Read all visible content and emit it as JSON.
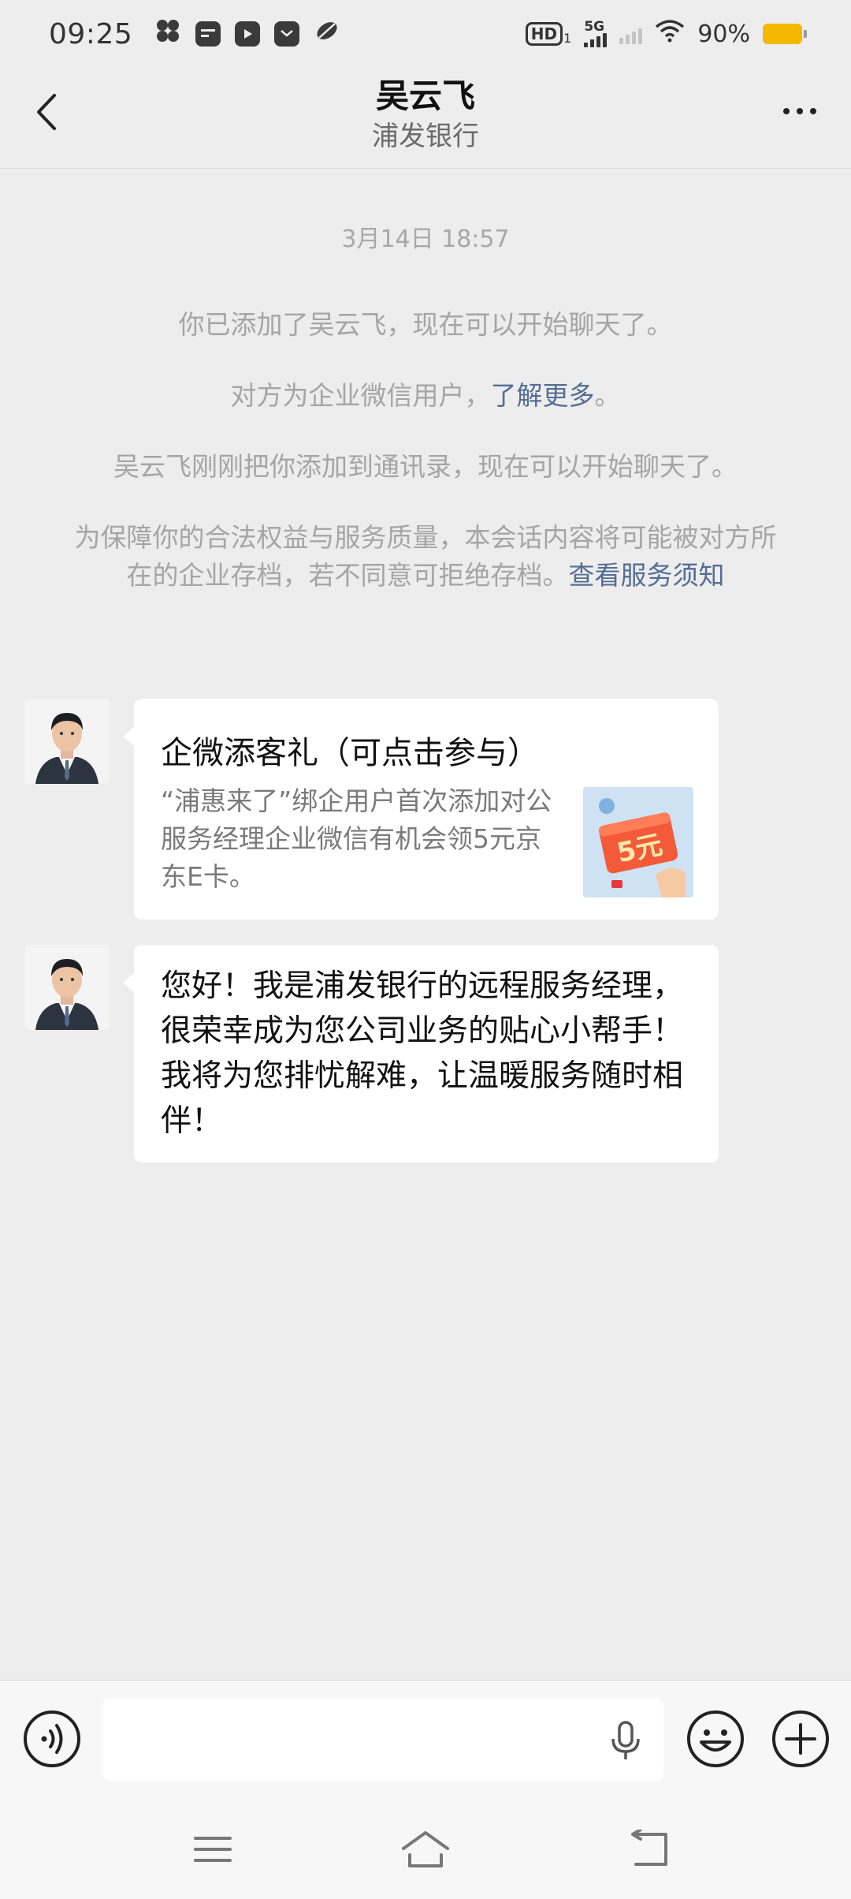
{
  "status_bar": {
    "time": "09:25",
    "network": "5G",
    "battery": "90%",
    "hd_label": "HD",
    "hd_sub": "1",
    "icons": [
      "fan-icon",
      "card-icon",
      "video-icon",
      "mail-icon",
      "leaf-icon",
      "wifi-icon"
    ]
  },
  "header": {
    "title": "吴云飞",
    "subtitle": "浦发银行"
  },
  "messages": {
    "timestamp": "3月14日 18:57",
    "system": [
      {
        "text": "你已添加了吴云飞，现在可以开始聊天了。"
      },
      {
        "text": "对方为企业微信用户，",
        "link": "了解更多",
        "suffix": "。"
      },
      {
        "text": "吴云飞刚刚把你添加到通讯录，现在可以开始聊天了。"
      },
      {
        "text": "为保障你的合法权益与服务质量，本会话内容将可能被对方所在的企业存档，若不同意可拒绝存档。",
        "link": "查看服务须知"
      }
    ],
    "card": {
      "title": "企微添客礼（可点击参与）",
      "description": "“浦惠来了”绑企用户首次添加对公服务经理企业微信有机会领5元京东E卡。",
      "thumb_text": "5元"
    },
    "text_message": "您好！我是浦发银行的远程服务经理，很荣幸成为您公司业务的贴心小帮手！我将为您排忧解难，让温暖服务随时相伴！"
  },
  "input_bar": {
    "placeholder": ""
  },
  "colors": {
    "background": "#ededed",
    "link": "#556d94",
    "battery": "#f5b800",
    "bubble": "#ffffff"
  }
}
